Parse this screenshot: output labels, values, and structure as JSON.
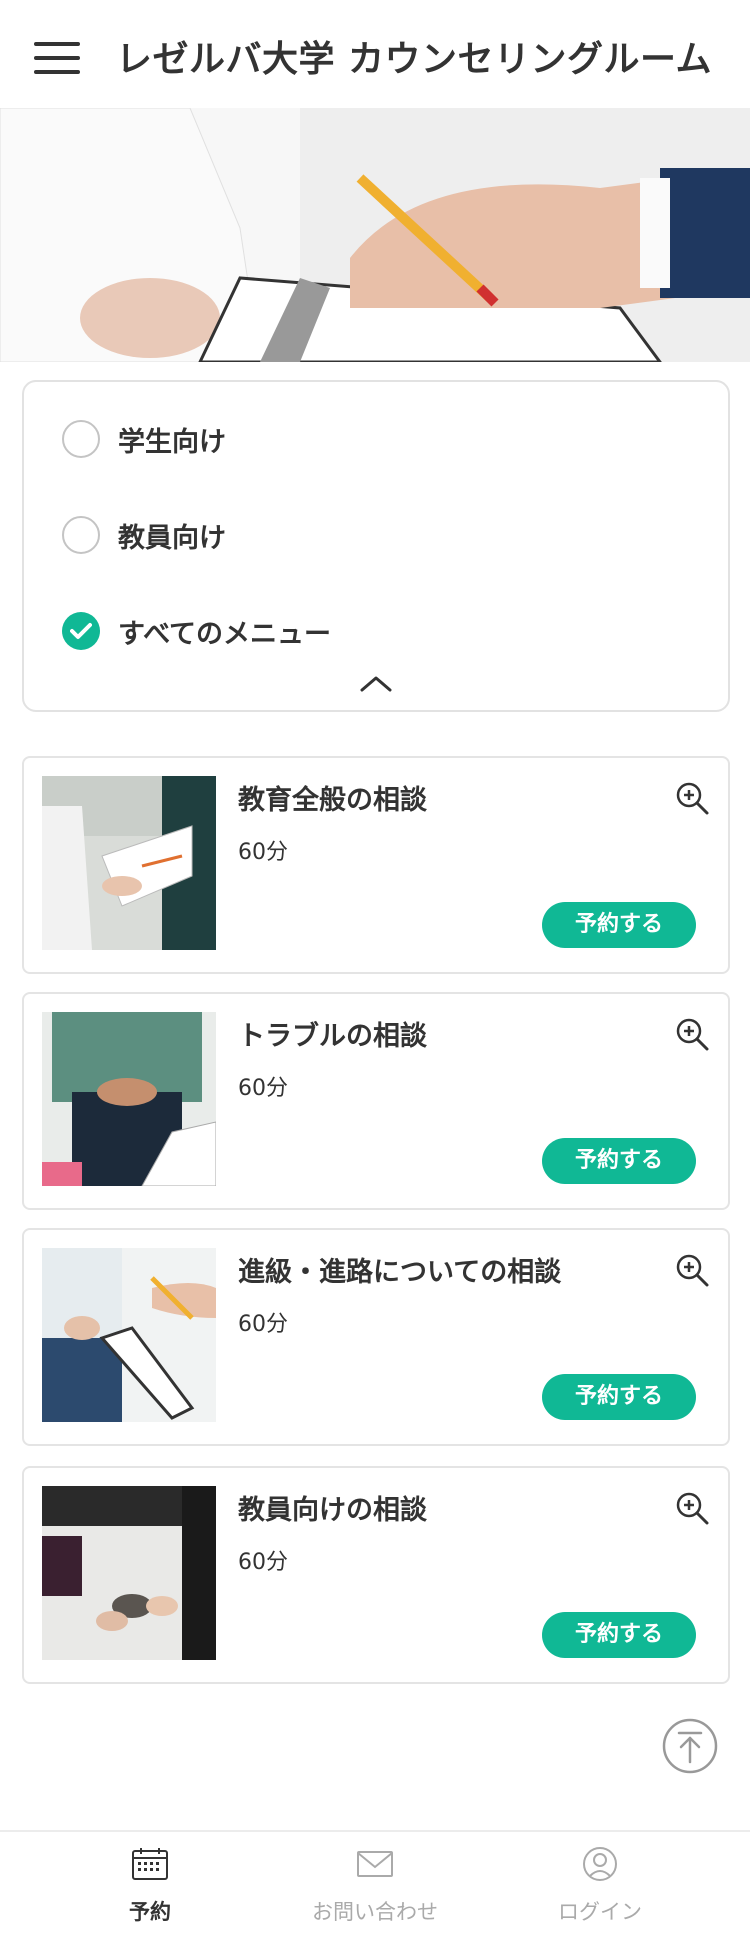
{
  "header": {
    "title": "レゼルバ大学 カウンセリングルーム"
  },
  "filters": {
    "options": [
      {
        "label": "学生向け",
        "checked": false
      },
      {
        "label": "教員向け",
        "checked": false
      },
      {
        "label": "すべてのメニュー",
        "checked": true
      }
    ]
  },
  "menus": [
    {
      "title": "教育全般の相談",
      "duration": "60分",
      "reserve_label": "予約する"
    },
    {
      "title": "トラブルの相談",
      "duration": "60分",
      "reserve_label": "予約する"
    },
    {
      "title": "進級・進路についての相談",
      "duration": "60分",
      "reserve_label": "予約する"
    },
    {
      "title": "教員向けの相談",
      "duration": "60分",
      "reserve_label": "予約する"
    }
  ],
  "bottom_nav": {
    "items": [
      {
        "label": "予約",
        "icon": "calendar-icon",
        "active": true
      },
      {
        "label": "お問い合わせ",
        "icon": "mail-icon",
        "active": false
      },
      {
        "label": "ログイン",
        "icon": "user-icon",
        "active": false
      }
    ]
  },
  "colors": {
    "accent": "#10b895",
    "text": "#333333",
    "muted": "#aaaaaa"
  }
}
